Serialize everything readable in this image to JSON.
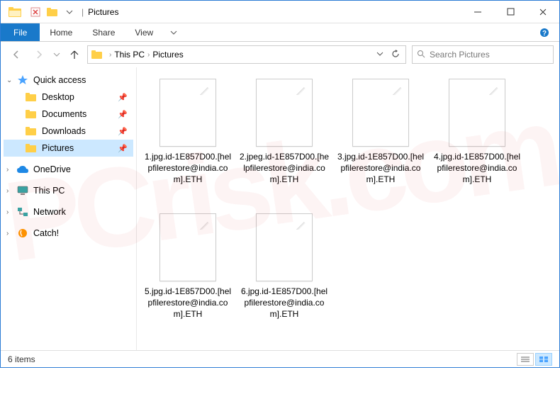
{
  "window": {
    "title": "Pictures",
    "controls": {
      "minimize": "–",
      "maximize": "□",
      "close": "✕"
    }
  },
  "ribbon": {
    "file": "File",
    "tabs": [
      "Home",
      "Share",
      "View"
    ]
  },
  "nav": {
    "back": "←",
    "forward": "→",
    "recent": "▾",
    "up": "↑"
  },
  "address": {
    "segments": [
      "This PC",
      "Pictures"
    ],
    "dropdown": "▾",
    "refresh": "↻"
  },
  "search": {
    "placeholder": "Search Pictures",
    "icon": "🔍"
  },
  "sidebar": {
    "quick_access": {
      "label": "Quick access",
      "caret": "▾"
    },
    "quick_items": [
      {
        "label": "Desktop",
        "pinned": true
      },
      {
        "label": "Documents",
        "pinned": true
      },
      {
        "label": "Downloads",
        "pinned": true
      },
      {
        "label": "Pictures",
        "pinned": true,
        "selected": true
      }
    ],
    "roots": [
      {
        "label": "OneDrive",
        "caret": "›",
        "icon": "onedrive"
      },
      {
        "label": "This PC",
        "caret": "›",
        "icon": "thispc"
      },
      {
        "label": "Network",
        "caret": "›",
        "icon": "network"
      },
      {
        "label": "Catch!",
        "caret": "›",
        "icon": "catch"
      }
    ]
  },
  "files": [
    {
      "name": "1.jpg.id-1E857D00.[helpfilerestore@india.com].ETH"
    },
    {
      "name": "2.jpeg.id-1E857D00.[helpfilerestore@india.com].ETH"
    },
    {
      "name": "3.jpg.id-1E857D00.[helpfilerestore@india.com].ETH"
    },
    {
      "name": "4.jpg.id-1E857D00.[helpfilerestore@india.com].ETH"
    },
    {
      "name": "5.jpg.id-1E857D00.[helpfilerestore@india.com].ETH"
    },
    {
      "name": "6.jpg.id-1E857D00.[helpfilerestore@india.com].ETH"
    }
  ],
  "status": {
    "text": "6 items"
  },
  "watermark": "PCrisk.com"
}
